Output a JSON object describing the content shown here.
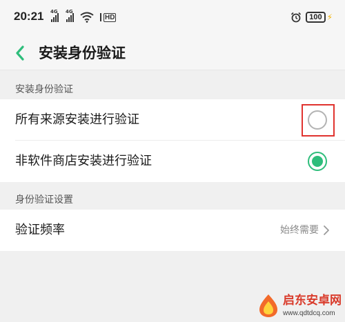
{
  "status_bar": {
    "time": "20:21",
    "signal_1_tag": "4G",
    "signal_2_tag": "4G",
    "hd_tag": "HD",
    "battery_level": "100",
    "icons": [
      "signal-icon",
      "signal-icon",
      "wifi-icon",
      "hd-icon",
      "alarm-icon",
      "battery-icon",
      "charging-icon"
    ]
  },
  "header": {
    "title": "安装身份验证",
    "back_icon": "chevron-left-icon",
    "accent_color": "#2ebd7b"
  },
  "sections": [
    {
      "header": "安装身份验证",
      "items": [
        {
          "label": "所有来源安装进行验证",
          "selected": false
        },
        {
          "label": "非软件商店安装进行验证",
          "selected": true
        }
      ]
    },
    {
      "header": "身份验证设置",
      "items": [
        {
          "label": "验证频率",
          "value": "始终需要",
          "icon": "chevron-right-icon"
        }
      ]
    }
  ],
  "annotation": {
    "color": "#e0322e"
  },
  "watermark": {
    "name": "启东安卓网",
    "url": "www.qdtdcq.com"
  }
}
